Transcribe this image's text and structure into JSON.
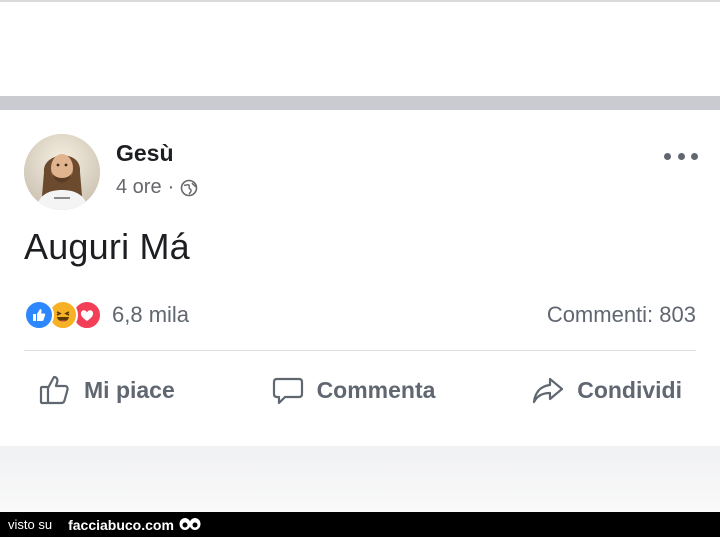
{
  "post": {
    "author": "Gesù",
    "time": "4 ore",
    "meta_separator": "·",
    "visibility_icon": "globe-icon",
    "text": "Auguri Má",
    "more_icon": "more-options-icon",
    "reactions": {
      "icons": [
        "like-reaction-icon",
        "haha-reaction-icon",
        "love-reaction-icon"
      ],
      "count": "6,8 mila"
    },
    "comments": "Commenti: 803"
  },
  "actions": {
    "like": "Mi piace",
    "comment": "Commenta",
    "share": "Condividi"
  },
  "watermark": {
    "prefix": "visto su",
    "site": "facciabuco.com"
  },
  "colors": {
    "text_primary": "#1c1e21",
    "text_secondary": "#606770",
    "like_blue": "#2d88ff",
    "haha_yellow": "#f7b125",
    "love_red": "#f33e58",
    "separator": "#c9cbd0"
  }
}
